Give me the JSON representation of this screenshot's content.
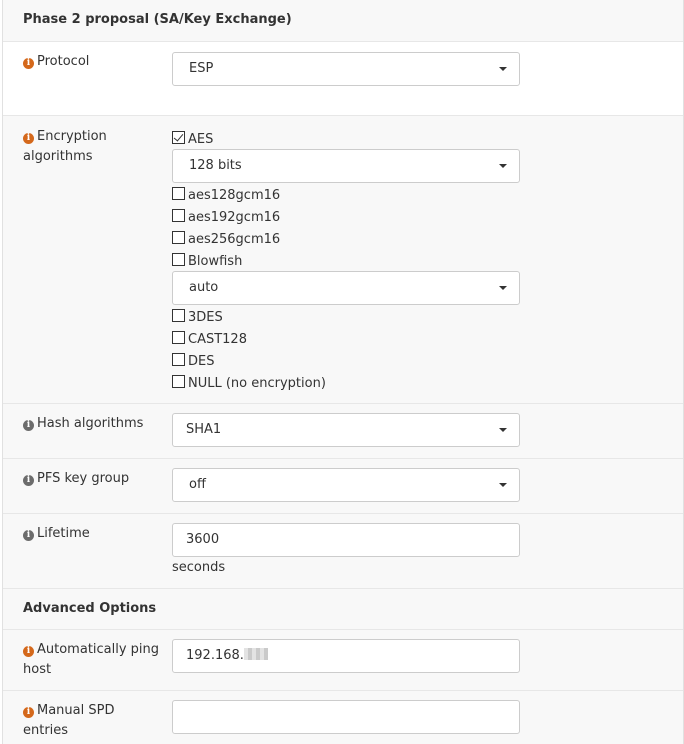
{
  "sections": {
    "phase2_title": "Phase 2 proposal (SA/Key Exchange)",
    "advanced_title": "Advanced Options"
  },
  "protocol": {
    "label": "Protocol",
    "value": "ESP"
  },
  "encryption": {
    "label_line1": "Encryption",
    "label_line2": "algorithms",
    "aes_label": "AES",
    "aes_bits": "128 bits",
    "aes128gcm16": "aes128gcm16",
    "aes192gcm16": "aes192gcm16",
    "aes256gcm16": "aes256gcm16",
    "blowfish_label": "Blowfish",
    "blowfish_value": "auto",
    "des3": "3DES",
    "cast128": "CAST128",
    "des": "DES",
    "null": "NULL (no encryption)"
  },
  "hash": {
    "label": "Hash algorithms",
    "value": "SHA1"
  },
  "pfs": {
    "label": "PFS key group",
    "value": "off"
  },
  "lifetime": {
    "label": "Lifetime",
    "value": "3600",
    "unit": "seconds"
  },
  "ping": {
    "label_line1": "Automatically ping",
    "label_line2": "host",
    "value": "192.168."
  },
  "spd": {
    "label": "Manual SPD entries",
    "value": ""
  },
  "colors": {
    "info_orange": "#d4681b",
    "info_gray": "#6c6c6c"
  }
}
